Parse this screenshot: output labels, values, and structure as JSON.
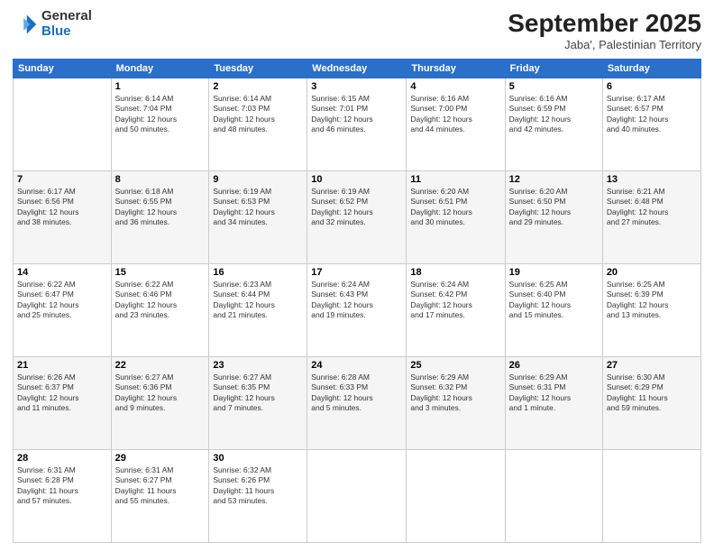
{
  "header": {
    "logo_general": "General",
    "logo_blue": "Blue",
    "month": "September 2025",
    "location": "Jaba', Palestinian Territory"
  },
  "days_of_week": [
    "Sunday",
    "Monday",
    "Tuesday",
    "Wednesday",
    "Thursday",
    "Friday",
    "Saturday"
  ],
  "weeks": [
    [
      {
        "day": "",
        "info": ""
      },
      {
        "day": "1",
        "info": "Sunrise: 6:14 AM\nSunset: 7:04 PM\nDaylight: 12 hours\nand 50 minutes."
      },
      {
        "day": "2",
        "info": "Sunrise: 6:14 AM\nSunset: 7:03 PM\nDaylight: 12 hours\nand 48 minutes."
      },
      {
        "day": "3",
        "info": "Sunrise: 6:15 AM\nSunset: 7:01 PM\nDaylight: 12 hours\nand 46 minutes."
      },
      {
        "day": "4",
        "info": "Sunrise: 6:16 AM\nSunset: 7:00 PM\nDaylight: 12 hours\nand 44 minutes."
      },
      {
        "day": "5",
        "info": "Sunrise: 6:16 AM\nSunset: 6:59 PM\nDaylight: 12 hours\nand 42 minutes."
      },
      {
        "day": "6",
        "info": "Sunrise: 6:17 AM\nSunset: 6:57 PM\nDaylight: 12 hours\nand 40 minutes."
      }
    ],
    [
      {
        "day": "7",
        "info": "Sunrise: 6:17 AM\nSunset: 6:56 PM\nDaylight: 12 hours\nand 38 minutes."
      },
      {
        "day": "8",
        "info": "Sunrise: 6:18 AM\nSunset: 6:55 PM\nDaylight: 12 hours\nand 36 minutes."
      },
      {
        "day": "9",
        "info": "Sunrise: 6:19 AM\nSunset: 6:53 PM\nDaylight: 12 hours\nand 34 minutes."
      },
      {
        "day": "10",
        "info": "Sunrise: 6:19 AM\nSunset: 6:52 PM\nDaylight: 12 hours\nand 32 minutes."
      },
      {
        "day": "11",
        "info": "Sunrise: 6:20 AM\nSunset: 6:51 PM\nDaylight: 12 hours\nand 30 minutes."
      },
      {
        "day": "12",
        "info": "Sunrise: 6:20 AM\nSunset: 6:50 PM\nDaylight: 12 hours\nand 29 minutes."
      },
      {
        "day": "13",
        "info": "Sunrise: 6:21 AM\nSunset: 6:48 PM\nDaylight: 12 hours\nand 27 minutes."
      }
    ],
    [
      {
        "day": "14",
        "info": "Sunrise: 6:22 AM\nSunset: 6:47 PM\nDaylight: 12 hours\nand 25 minutes."
      },
      {
        "day": "15",
        "info": "Sunrise: 6:22 AM\nSunset: 6:46 PM\nDaylight: 12 hours\nand 23 minutes."
      },
      {
        "day": "16",
        "info": "Sunrise: 6:23 AM\nSunset: 6:44 PM\nDaylight: 12 hours\nand 21 minutes."
      },
      {
        "day": "17",
        "info": "Sunrise: 6:24 AM\nSunset: 6:43 PM\nDaylight: 12 hours\nand 19 minutes."
      },
      {
        "day": "18",
        "info": "Sunrise: 6:24 AM\nSunset: 6:42 PM\nDaylight: 12 hours\nand 17 minutes."
      },
      {
        "day": "19",
        "info": "Sunrise: 6:25 AM\nSunset: 6:40 PM\nDaylight: 12 hours\nand 15 minutes."
      },
      {
        "day": "20",
        "info": "Sunrise: 6:25 AM\nSunset: 6:39 PM\nDaylight: 12 hours\nand 13 minutes."
      }
    ],
    [
      {
        "day": "21",
        "info": "Sunrise: 6:26 AM\nSunset: 6:37 PM\nDaylight: 12 hours\nand 11 minutes."
      },
      {
        "day": "22",
        "info": "Sunrise: 6:27 AM\nSunset: 6:36 PM\nDaylight: 12 hours\nand 9 minutes."
      },
      {
        "day": "23",
        "info": "Sunrise: 6:27 AM\nSunset: 6:35 PM\nDaylight: 12 hours\nand 7 minutes."
      },
      {
        "day": "24",
        "info": "Sunrise: 6:28 AM\nSunset: 6:33 PM\nDaylight: 12 hours\nand 5 minutes."
      },
      {
        "day": "25",
        "info": "Sunrise: 6:29 AM\nSunset: 6:32 PM\nDaylight: 12 hours\nand 3 minutes."
      },
      {
        "day": "26",
        "info": "Sunrise: 6:29 AM\nSunset: 6:31 PM\nDaylight: 12 hours\nand 1 minute."
      },
      {
        "day": "27",
        "info": "Sunrise: 6:30 AM\nSunset: 6:29 PM\nDaylight: 11 hours\nand 59 minutes."
      }
    ],
    [
      {
        "day": "28",
        "info": "Sunrise: 6:31 AM\nSunset: 6:28 PM\nDaylight: 11 hours\nand 57 minutes."
      },
      {
        "day": "29",
        "info": "Sunrise: 6:31 AM\nSunset: 6:27 PM\nDaylight: 11 hours\nand 55 minutes."
      },
      {
        "day": "30",
        "info": "Sunrise: 6:32 AM\nSunset: 6:26 PM\nDaylight: 11 hours\nand 53 minutes."
      },
      {
        "day": "",
        "info": ""
      },
      {
        "day": "",
        "info": ""
      },
      {
        "day": "",
        "info": ""
      },
      {
        "day": "",
        "info": ""
      }
    ]
  ]
}
